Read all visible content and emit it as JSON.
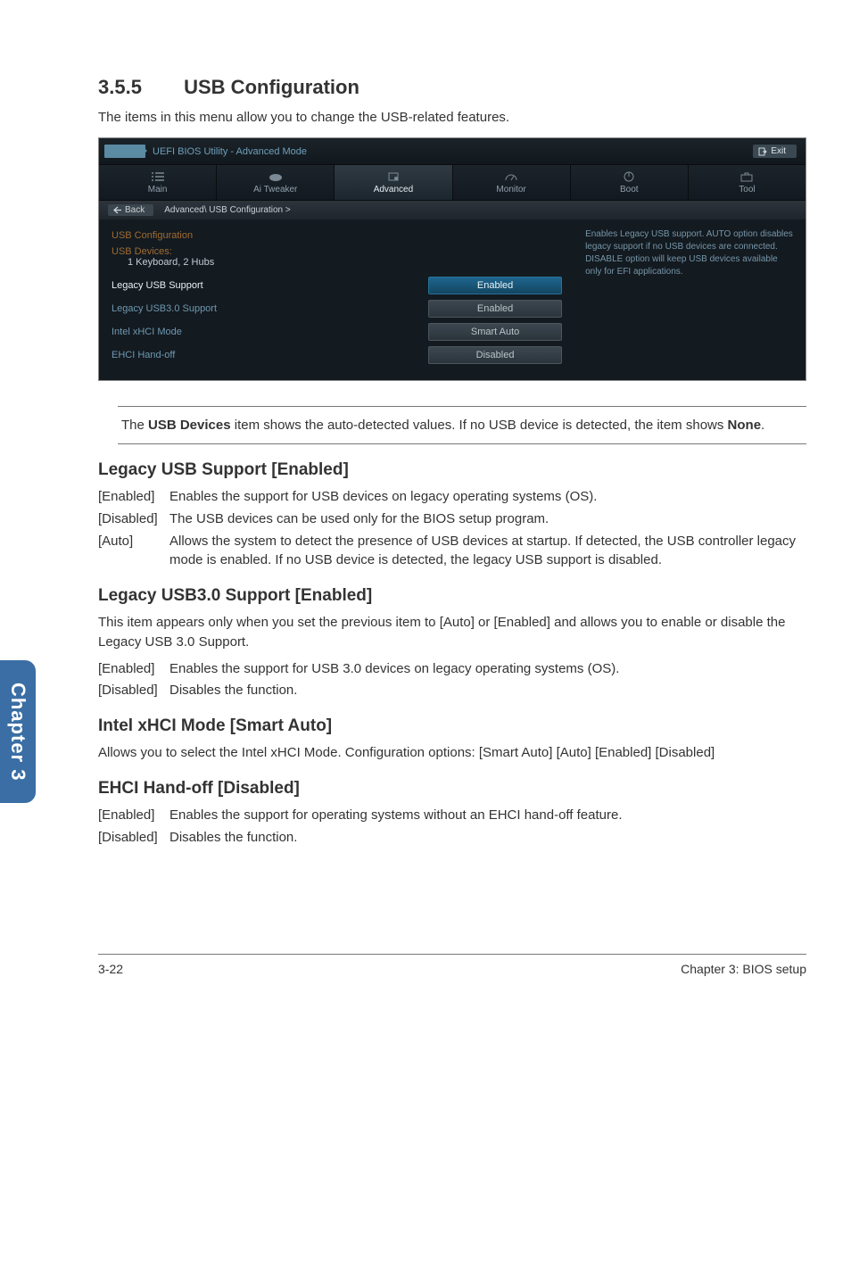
{
  "sidetab": "Chapter 3",
  "section": {
    "num": "3.5.5",
    "title": "USB Configuration"
  },
  "intro": "The items in this menu allow you to change the USB-related features.",
  "bios": {
    "top_title": "UEFI BIOS Utility - Advanced Mode",
    "exit": "Exit",
    "tabs": [
      "Main",
      "Ai Tweaker",
      "Advanced",
      "Monitor",
      "Boot",
      "Tool"
    ],
    "active_tab_index": 2,
    "back": "Back",
    "breadcrumb": "Advanced\\ USB Configuration  >",
    "cfg_title": "USB Configuration",
    "devices_label": "USB Devices:",
    "devices_value": "1 Keyboard, 2 Hubs",
    "rows": [
      {
        "label": "Legacy USB Support",
        "value": "Enabled",
        "selected": true
      },
      {
        "label": "Legacy USB3.0 Support",
        "value": "Enabled",
        "selected": false
      },
      {
        "label": "Intel xHCI Mode",
        "value": "Smart Auto",
        "selected": false
      },
      {
        "label": "EHCI Hand-off",
        "value": "Disabled",
        "selected": false
      }
    ],
    "help": "Enables Legacy USB support. AUTO option disables legacy support if no USB devices are connected. DISABLE option will keep USB devices available only for EFI applications."
  },
  "note": {
    "pre": "The ",
    "bold1": "USB Devices",
    "mid": " item shows the auto-detected values. If no USB device is detected, the item shows ",
    "bold2": "None",
    "post": "."
  },
  "sec1": {
    "title": "Legacy USB Support [Enabled]",
    "rows": [
      {
        "term": "[Enabled]",
        "desc": "Enables the support for USB devices on legacy operating systems (OS)."
      },
      {
        "term": "[Disabled]",
        "desc": "The USB devices can be used only for the BIOS setup program."
      },
      {
        "term": "[Auto]",
        "desc": "Allows the system to detect the presence of USB devices at startup. If detected, the USB controller legacy mode is enabled. If no USB device is detected, the legacy USB support is disabled."
      }
    ]
  },
  "sec2": {
    "title": "Legacy USB3.0 Support [Enabled]",
    "intro": "This item appears only when you set the previous item to [Auto] or [Enabled] and allows you to enable or disable the Legacy USB 3.0 Support.",
    "rows": [
      {
        "term": "[Enabled]",
        "desc": "Enables the support for USB 3.0 devices on legacy operating systems (OS)."
      },
      {
        "term": "[Disabled]",
        "desc": "Disables the function."
      }
    ]
  },
  "sec3": {
    "title": "Intel xHCI Mode [Smart Auto]",
    "para": "Allows you to select the Intel xHCI Mode. Configuration options: [Smart Auto] [Auto] [Enabled] [Disabled]"
  },
  "sec4": {
    "title": "EHCI Hand-off [Disabled]",
    "rows": [
      {
        "term": "[Enabled]",
        "desc": "Enables the support for operating systems without an EHCI hand-off feature."
      },
      {
        "term": "[Disabled]",
        "desc": "Disables the function."
      }
    ]
  },
  "footer": {
    "left": "3-22",
    "right": "Chapter 3: BIOS setup"
  }
}
